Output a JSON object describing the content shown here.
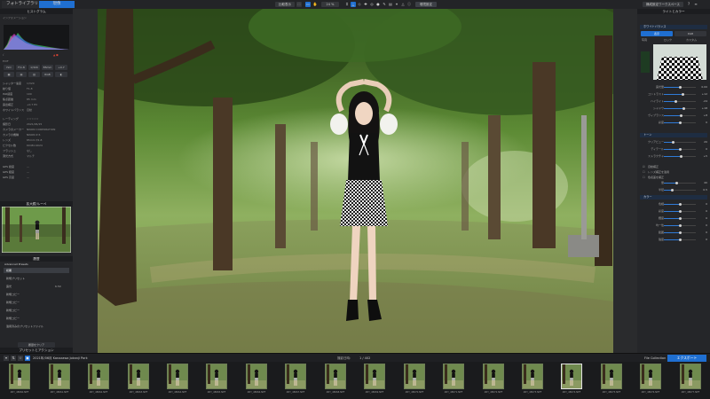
{
  "topbar": {
    "tabs": [
      "フォトライブラリ",
      "現像"
    ],
    "left_buttons": [
      "比較表示",
      "全画面"
    ],
    "zoom": "24 %",
    "right_button": "環境設定",
    "workspace": "構成設定ワークスペース",
    "nav_label": "ナビゲート"
  },
  "left_panel": {
    "histogram_title": "ヒストグラム",
    "info_title": "インフォメーション",
    "exif_rows": [
      {
        "label": "シャッター速度",
        "value": "1/320"
      },
      {
        "label": "絞り値",
        "value": "F1.8"
      },
      {
        "label": "ISO感度",
        "value": "100"
      },
      {
        "label": "焦点距離",
        "value": "85 mm"
      },
      {
        "label": "露出補正",
        "value": "+0.7 EV"
      },
      {
        "label": "ホワイトバランス",
        "value": "自動"
      }
    ],
    "shooting_rows": [
      {
        "label": "レーティング",
        "value": "☆☆☆☆☆"
      },
      {
        "label": "撮影日",
        "value": "2021/06/15"
      },
      {
        "label": "カメラのメーカー",
        "value": "NIKON CORPORATION"
      },
      {
        "label": "カメラの機種",
        "value": "NIKON Z 6"
      },
      {
        "label": "レンズ",
        "value": "85mm f/1.8"
      },
      {
        "label": "ピクセル数",
        "value": "6048×4024"
      },
      {
        "label": "フラッシュ",
        "value": "なし"
      },
      {
        "label": "測光方式",
        "value": "マルチ"
      }
    ],
    "gps_rows": [
      {
        "label": "GPS 緯度",
        "value": "—"
      },
      {
        "label": "GPS 経度",
        "value": "—"
      },
      {
        "label": "GPS 高度",
        "value": "—"
      }
    ],
    "buttons_row1": [
      "ISO",
      "F/1.8",
      "1/320",
      "85mm",
      "+0.7"
    ],
    "buttons_row2": [
      "",
      "",
      "",
      "RGB",
      ""
    ],
    "navigator_title": "拡大鏡/ルーペ",
    "presets_title": "履歴",
    "presets_header": "Advanced Presets",
    "presets": [
      "初期",
      "新規プリセット",
      "露光",
      "新規コピー",
      "新規コピー",
      "新規コピー",
      "新規コピー",
      "適用済みのプリセットファイル"
    ],
    "presets_selected": 0,
    "preset_value": "6.50",
    "clear_button": "履歴をクリア",
    "bottom_title": "プリセットとアクション"
  },
  "right_panel": {
    "title": "ライトとカラー",
    "wb_title": "ホワイトバランス",
    "wb_options": [
      "表示",
      "RGB"
    ],
    "wb_modes": [
      "写真",
      "ロック",
      "カスタム"
    ],
    "sliders_1": [
      {
        "label": "露光量",
        "value": "0.00",
        "level": 0.5
      },
      {
        "label": "コントラスト",
        "value": "+12",
        "level": 0.6
      },
      {
        "label": "ハイライト",
        "value": "-24",
        "level": 0.38
      },
      {
        "label": "シャドウ",
        "value": "+18",
        "level": 0.62
      },
      {
        "label": "ヴィブランス",
        "value": "+8",
        "level": 0.55
      },
      {
        "label": "彩度",
        "value": "0",
        "level": 0.5
      }
    ],
    "section2": "トーン",
    "sliders_2": [
      {
        "label": "クリアビュー",
        "value": "20",
        "level": 0.3
      },
      {
        "label": "ディテール",
        "value": "0",
        "level": 0.5
      },
      {
        "label": "ストラクチャ",
        "value": "+5",
        "level": 0.55
      }
    ],
    "checks": [
      "自動補正",
      "レンズ補正を適用",
      "色収差を補正"
    ],
    "sliders_3": [
      {
        "label": "量",
        "value": "40",
        "level": 0.4
      },
      {
        "label": "半径",
        "value": "0.5",
        "level": 0.25
      }
    ],
    "section3": "カラー",
    "sliders_4": [
      {
        "label": "色相",
        "value": "0",
        "level": 0.5
      },
      {
        "label": "彩度",
        "value": "0",
        "level": 0.5
      },
      {
        "label": "輝度",
        "value": "0",
        "level": 0.5
      },
      {
        "label": "均一性",
        "value": "0",
        "level": 0.5
      },
      {
        "label": "範囲",
        "value": "0",
        "level": 0.5
      },
      {
        "label": "強度",
        "value": "0",
        "level": 0.5
      }
    ]
  },
  "filmbar": {
    "path": "2021年/06月 Kanazawa Jokanji Park",
    "count": "1 / 402",
    "sort_label": "撮影日時:",
    "collection": "File Collection",
    "export_button": "エクスポート"
  },
  "filmstrip": {
    "items": [
      "Z6Y_48060.NEF",
      "Z6Y_48061.NEF",
      "Z6Y_48062.NEF",
      "Z6Y_48063.NEF",
      "Z6Y_48064.NEF",
      "Z6Y_48065.NEF",
      "Z6Y_48066.NEF",
      "Z6Y_48067.NEF",
      "Z6Y_48068.NEF",
      "Z6Y_48069.NEF",
      "Z6Y_48070.NEF",
      "Z6Y_48071.NEF",
      "Z6Y_48072.NEF",
      "Z6Y_48073.NEF",
      "Z6Y_48074.NEF",
      "Z6Y_48075.NEF",
      "Z6Y_48076.NEF",
      "Z6Y_48077.NEF"
    ],
    "selected": 14
  }
}
